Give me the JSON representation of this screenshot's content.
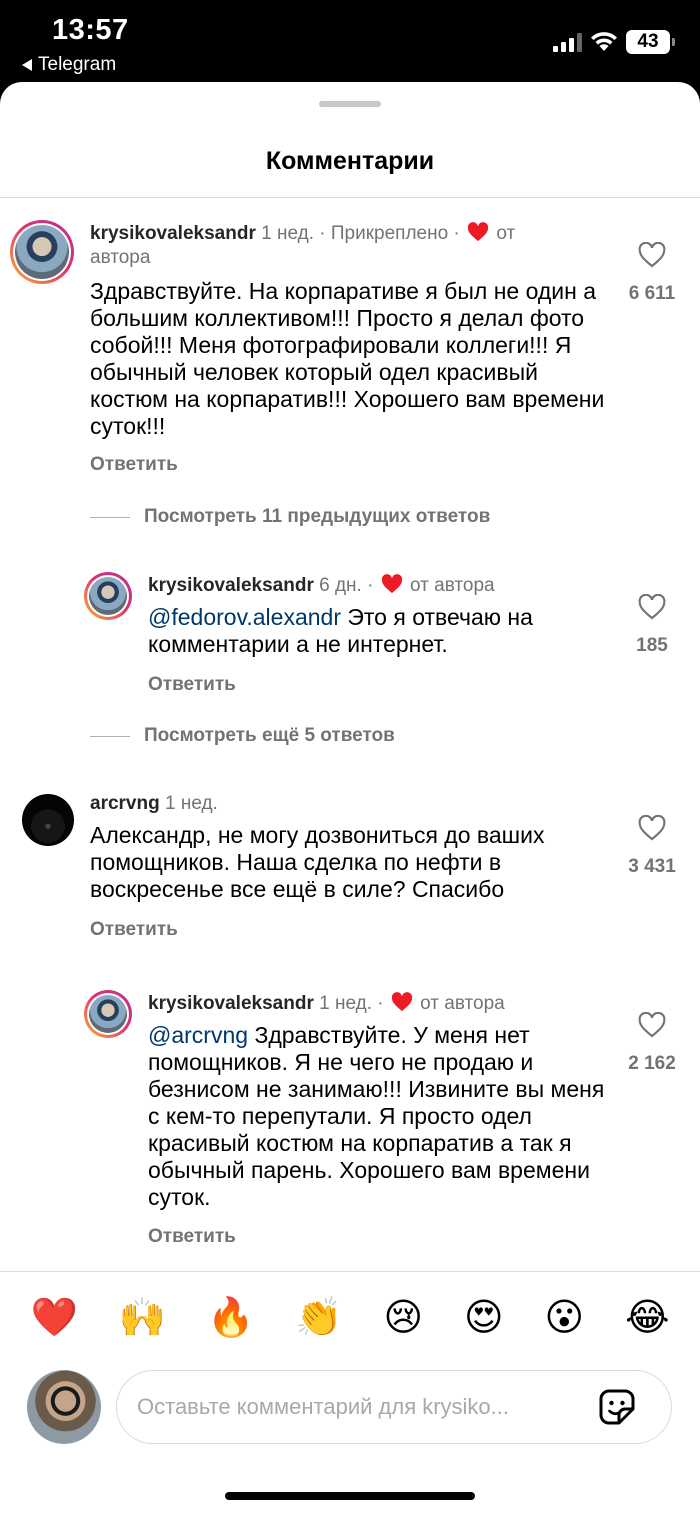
{
  "status_bar": {
    "time": "13:57",
    "back_app": "Telegram",
    "battery": "43"
  },
  "sheet": {
    "title": "Комментарии"
  },
  "comments": [
    {
      "username": "krysikovaleksandr",
      "time": "1 нед.",
      "pinned": "· Прикреплено ·",
      "author_like": "от автора",
      "text": "Здравствуйте. На корпаративе я был не один а большим коллективом!!! Просто я делал фото собой!!! Меня фотографировали коллеги!!! Я обычный человек который одел красивый костюм на корпаратив!!! Хорошего вам времени суток!!!",
      "reply_label": "Ответить",
      "likes": "6 611"
    },
    {
      "username": "krysikovaleksandr",
      "time": "6 дн.",
      "author_like": "от автора",
      "mention": "@fedorov.alexandr",
      "text": "Это я отвечаю на комментарии а не интернет.",
      "reply_label": "Ответить",
      "likes": "185"
    },
    {
      "username": "arcrvng",
      "time": "1 нед.",
      "text": "Александр, не могу дозвониться до ваших помощников. Наша сделка по нефти в воскресенье все ещё в силе? Спасибо",
      "reply_label": "Ответить",
      "likes": "3 431"
    },
    {
      "username": "krysikovaleksandr",
      "time": "1 нед.",
      "author_like": "от автора",
      "mention": "@arcrvng",
      "text": "Здравствуйте. У меня нет помощников. Я не чего не продаю и безнисом не занимаю!!! Извините вы меня с кем-то перепутали. Я просто одел красивый костюм на корпаратив а так я обычный парень. Хорошего вам времени суток.",
      "reply_label": "Ответить",
      "likes": "2 162"
    }
  ],
  "threads": {
    "previous": "Посмотреть 11 предыдущих ответов",
    "more": "Посмотреть ещё 5 ответов"
  },
  "reactions": [
    "❤️",
    "🙌",
    "🔥",
    "👏",
    "😢",
    "😍",
    "😮",
    "😂"
  ],
  "composer": {
    "placeholder": "Оставьте комментарий для krysiko..."
  },
  "icons": {
    "like": "heart-outline-icon",
    "author_heart": "heart-filled-icon",
    "sticker": "sticker-icon"
  },
  "colors": {
    "author_heart": "#ed1c24",
    "mention": "#00376b",
    "secondary_text": "#737373"
  }
}
